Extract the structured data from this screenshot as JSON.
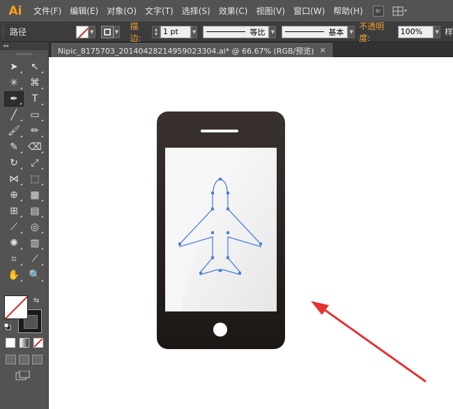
{
  "app": {
    "logo": "Ai"
  },
  "menu": [
    "文件(F)",
    "编辑(E)",
    "对象(O)",
    "文字(T)",
    "选择(S)",
    "效果(C)",
    "视图(V)",
    "窗口(W)",
    "帮助(H)"
  ],
  "menubar_icons": {
    "bridge": "Br",
    "arrange": "arrange-documents-icon"
  },
  "control": {
    "selection_label": "路径",
    "stroke_label": "描边:",
    "stroke_weight": "1 pt",
    "profile_label": "等比",
    "brush_label": "基本",
    "opacity_label": "不透明度:",
    "opacity_value": "100%",
    "more_label": "样"
  },
  "document_tab": {
    "title": "Nipic_8175703_20140428214959023304.ai*  @  66.67%  (RGB/预览)",
    "close": "✕"
  },
  "toolpanel_header": "◂◂",
  "tools": [
    {
      "name": "selection-tool",
      "glyph": "➤"
    },
    {
      "name": "direct-selection-tool",
      "glyph": "↖"
    },
    {
      "name": "magic-wand-tool",
      "glyph": "✳"
    },
    {
      "name": "lasso-tool",
      "glyph": "⌘"
    },
    {
      "name": "pen-tool",
      "glyph": "✒"
    },
    {
      "name": "type-tool",
      "glyph": "T"
    },
    {
      "name": "line-segment-tool",
      "glyph": "╱"
    },
    {
      "name": "rectangle-tool",
      "glyph": "▭"
    },
    {
      "name": "paintbrush-tool",
      "glyph": "🖌"
    },
    {
      "name": "pencil-tool",
      "glyph": "✏"
    },
    {
      "name": "blob-brush-tool",
      "glyph": "✎"
    },
    {
      "name": "eraser-tool",
      "glyph": "⌫"
    },
    {
      "name": "rotate-tool",
      "glyph": "↻"
    },
    {
      "name": "scale-tool",
      "glyph": "⤢"
    },
    {
      "name": "width-tool",
      "glyph": "⋈"
    },
    {
      "name": "free-transform-tool",
      "glyph": "⬚"
    },
    {
      "name": "shape-builder-tool",
      "glyph": "⊕"
    },
    {
      "name": "perspective-grid-tool",
      "glyph": "▦"
    },
    {
      "name": "mesh-tool",
      "glyph": "⊞"
    },
    {
      "name": "gradient-tool",
      "glyph": "▤"
    },
    {
      "name": "eyedropper-tool",
      "glyph": "⟋"
    },
    {
      "name": "blend-tool",
      "glyph": "◎"
    },
    {
      "name": "symbol-sprayer-tool",
      "glyph": "✺"
    },
    {
      "name": "column-graph-tool",
      "glyph": "▥"
    },
    {
      "name": "artboard-tool",
      "glyph": "⌗"
    },
    {
      "name": "slice-tool",
      "glyph": "⟋"
    },
    {
      "name": "hand-tool",
      "glyph": "✋"
    },
    {
      "name": "zoom-tool",
      "glyph": "🔍"
    }
  ],
  "colors": {
    "menubar": "#535353",
    "controlbar": "#3c3c3c",
    "accent_orange": "#f0a030",
    "path_blue": "#4a7fe0",
    "arrow_red": "#e53030"
  }
}
